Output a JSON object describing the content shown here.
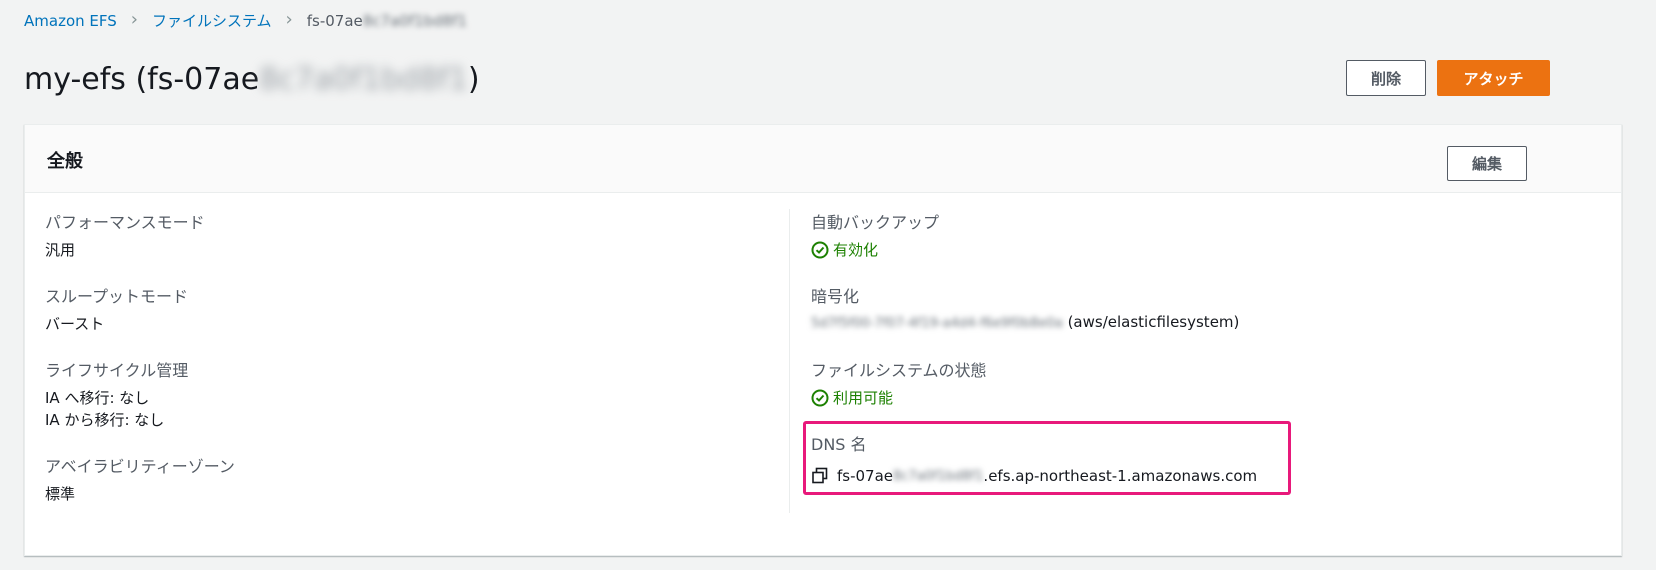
{
  "breadcrumb": {
    "items": [
      "Amazon EFS",
      "ファイルシステム"
    ],
    "current_prefix": "fs-07ae",
    "current_blurred": "8c7a0f1bd8f1"
  },
  "header": {
    "title_prefix": "my-efs (fs-07ae",
    "title_blurred": "8c7a0f1bd8f1",
    "title_suffix": ")",
    "delete_label": "削除",
    "attach_label": "アタッチ"
  },
  "general": {
    "section_title": "全般",
    "edit_label": "編集",
    "performance_mode": {
      "label": "パフォーマンスモード",
      "value": "汎用"
    },
    "throughput_mode": {
      "label": "スループットモード",
      "value": "バースト"
    },
    "lifecycle": {
      "label": "ライフサイクル管理",
      "line1": "IA へ移行: なし",
      "line2": "IA から移行: なし"
    },
    "availability_zone": {
      "label": "アベイラビリティーゾーン",
      "value": "標準"
    },
    "auto_backup": {
      "label": "自動バックアップ",
      "value": "有効化"
    },
    "encryption": {
      "label": "暗号化",
      "key_blurred": "5d7f5f00-7f07-4f19-a4d4-f6e9f0b8e0a",
      "suffix": "(aws/elasticfilesystem)"
    },
    "fs_state": {
      "label": "ファイルシステムの状態",
      "value": "利用可能"
    },
    "dns": {
      "label": "DNS 名",
      "prefix": "fs-07ae",
      "blurred": "8c7a0f1bd8f1",
      "suffix": ".efs.ap-northeast-1.amazonaws.com"
    }
  },
  "colors": {
    "accent": "#ec7211",
    "link": "#0073bb",
    "success": "#1d8102",
    "highlight": "#e8197b"
  },
  "icons": {
    "breadcrumb_separator": "chevron-right-icon",
    "status": "check-circle-icon",
    "copy": "copy-icon"
  }
}
